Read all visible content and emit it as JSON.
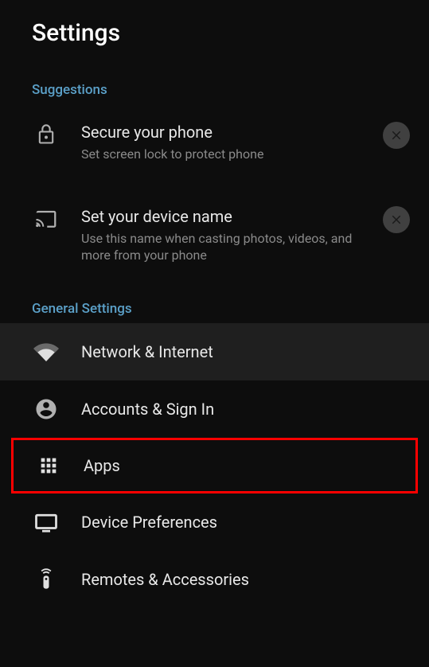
{
  "header": {
    "title": "Settings"
  },
  "sections": {
    "suggestions": {
      "label": "Suggestions",
      "items": [
        {
          "title": "Secure your phone",
          "subtitle": "Set screen lock to protect phone"
        },
        {
          "title": "Set your device name",
          "subtitle": "Use this name when casting photos, videos, and more from your phone"
        }
      ]
    },
    "general": {
      "label": "General Settings",
      "items": [
        {
          "title": "Network & Internet"
        },
        {
          "title": "Accounts & Sign In"
        },
        {
          "title": "Apps"
        },
        {
          "title": "Device Preferences"
        },
        {
          "title": "Remotes & Accessories"
        }
      ]
    }
  }
}
